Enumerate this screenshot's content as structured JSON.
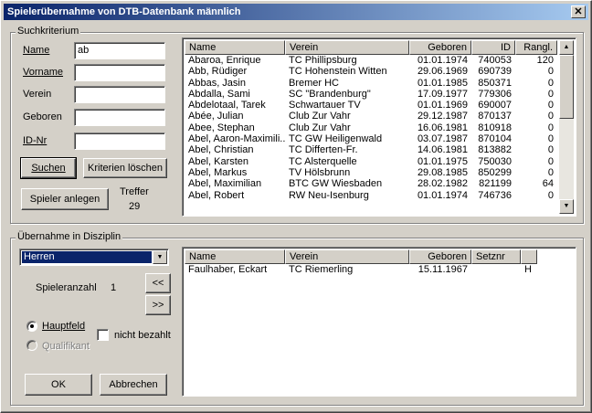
{
  "window": {
    "title": "Spielerübernahme von DTB-Datenbank männlich",
    "close_label": "✕"
  },
  "search": {
    "group_label": "Suchkriterium",
    "fields": {
      "name": {
        "label": "Name",
        "value": "ab"
      },
      "vorname": {
        "label": "Vorname",
        "value": ""
      },
      "verein": {
        "label": "Verein",
        "value": ""
      },
      "geboren": {
        "label": "Geboren",
        "value": ""
      },
      "idnr": {
        "label": "ID-Nr",
        "value": ""
      }
    },
    "buttons": {
      "suchen": "Suchen",
      "kriterien_loeschen": "Kriterien löschen",
      "spieler_anlegen": "Spieler anlegen"
    },
    "treffer_label": "Treffer",
    "treffer_count": "29"
  },
  "results": {
    "columns": [
      "Name",
      "Verein",
      "Geboren",
      "ID",
      "Rangl."
    ],
    "rows": [
      [
        "Abaroa, Enrique",
        "TC Phillipsburg",
        "01.01.1974",
        "740053",
        "120"
      ],
      [
        "Abb, Rüdiger",
        "TC Hohenstein Witten",
        "29.06.1969",
        "690739",
        "0"
      ],
      [
        "Abbas, Jasin",
        "Bremer HC",
        "01.01.1985",
        "850371",
        "0"
      ],
      [
        "Abdalla, Sami",
        "SC \"Brandenburg\"",
        "17.09.1977",
        "779306",
        "0"
      ],
      [
        "Abdelotaal, Tarek",
        "Schwartauer TV",
        "01.01.1969",
        "690007",
        "0"
      ],
      [
        "Abée, Julian",
        "Club Zur Vahr",
        "29.12.1987",
        "870137",
        "0"
      ],
      [
        "Abee, Stephan",
        "Club Zur Vahr",
        "16.06.1981",
        "810918",
        "0"
      ],
      [
        "Abel, Aaron-Maximili...",
        "TC GW Heiligenwald",
        "03.07.1987",
        "870104",
        "0"
      ],
      [
        "Abel, Christian",
        "TC Differten-Fr.",
        "14.06.1981",
        "813882",
        "0"
      ],
      [
        "Abel, Karsten",
        "TC Alsterquelle",
        "01.01.1975",
        "750030",
        "0"
      ],
      [
        "Abel, Markus",
        "TV Hölsbrunn",
        "29.08.1985",
        "850299",
        "0"
      ],
      [
        "Abel, Maximilian",
        "BTC GW Wiesbaden",
        "28.02.1982",
        "821199",
        "64"
      ],
      [
        "Abel, Robert",
        "RW Neu-Isenburg",
        "01.01.1974",
        "746736",
        "0"
      ]
    ]
  },
  "transfer": {
    "group_label": "Übernahme in Disziplin",
    "discipline_selected": "Herren",
    "spieleranzahl_label": "Spieleranzahl",
    "spieleranzahl_value": "1",
    "btn_left": "<<",
    "btn_right": ">>",
    "radio_hauptfeld": "Hauptfeld",
    "radio_qualifikant": "Qualifikant",
    "checkbox_nicht_bezahlt": "nicht bezahlt",
    "ok_label": "OK",
    "abbrechen_label": "Abbrechen"
  },
  "selected": {
    "columns": [
      "Name",
      "Verein",
      "Geboren",
      "Setznr",
      ""
    ],
    "rows": [
      [
        "Faulhaber, Eckart",
        "TC Riemerling",
        "15.11.1967",
        "",
        "H"
      ]
    ]
  }
}
